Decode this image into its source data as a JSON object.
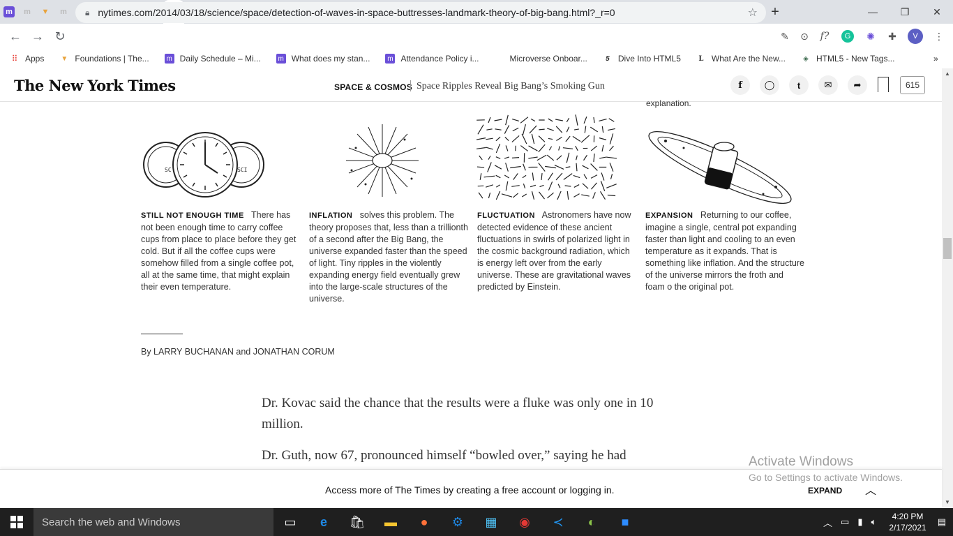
{
  "browser": {
    "url": "nytimes.com/2014/03/18/science/space/detection-of-waves-in-space-buttresses-landmark-theory-of-big-bang.html?_r=0",
    "new_tab_label": "+",
    "bookmarks": [
      {
        "label": "Apps",
        "icon": "apps-grid-icon",
        "color": "#e8453c"
      },
      {
        "label": "Foundations | The...",
        "icon": "foundations-icon",
        "color": "#e8a33d"
      },
      {
        "label": "Daily Schedule – Mi...",
        "icon": "microverse-icon",
        "color": "#6a4fd8"
      },
      {
        "label": "What does my stan...",
        "icon": "microverse-icon",
        "color": "#6a4fd8"
      },
      {
        "label": "Attendance Policy i...",
        "icon": "microverse-icon",
        "color": "#6a4fd8"
      },
      {
        "label": "Microverse Onboar...",
        "icon": "blank-icon",
        "color": "#ffffff"
      },
      {
        "label": "Dive Into HTML5",
        "icon": "five-icon",
        "color": "#111111"
      },
      {
        "label": "What Are the New...",
        "icon": "l-icon",
        "color": "#111111"
      },
      {
        "label": "HTML5 - New Tags...",
        "icon": "diamond-icon",
        "color": "#3d6b4f"
      }
    ],
    "more_bookmarks": "»",
    "profile_initial": "V"
  },
  "nyt": {
    "logo": "The New York Times",
    "section": "SPACE & COSMOS",
    "headline": "Space Ripples Reveal Big Bang’s Smoking Gun",
    "comment_count": "615",
    "share": {
      "facebook": "f",
      "twitter": "t"
    }
  },
  "graphic": {
    "top_cut": "explanation.",
    "mug_left_label": "SC",
    "mug_right_label": "SCI",
    "columns": [
      {
        "heading": "STILL NOT ENOUGH TIME",
        "text": "There has not been enough time to carry coffee cups from place to place before they get cold. But if all the coffee cups were somehow filled from a single coffee pot, all at the same time, that might explain their even temperature."
      },
      {
        "heading": "INFLATION",
        "text": "solves this problem. The theory proposes that, less than a trillionth of a second after the Big Bang, the universe expanded faster than the speed of light. Tiny ripples in the violently expanding energy field eventually grew into the large-scale structures of the universe."
      },
      {
        "heading": "FLUCTUATION",
        "text": "Astronomers have now detected evidence of these ancient fluctuations in swirls of polarized light in the cosmic background radiation, which is energy left over from the early universe. These are gravitational waves predicted by Einstein."
      },
      {
        "heading": "EXPANSION",
        "text": "Returning to our coffee, imagine a single, central pot expanding faster than light and cooling to an even temperature as it expands. That is something like inflation. And the structure of the universe mirrors the froth and foam o the original pot."
      }
    ],
    "byline": "By LARRY BUCHANAN and JONATHAN CORUM"
  },
  "article": {
    "para1": "Dr. Kovac said the chance that the results were a fluke was only one in 10 million.",
    "para2": "Dr. Guth, now 67, pronounced himself “bowled over,” saying he had"
  },
  "footer": {
    "text": "Access more of The Times by creating a free account or logging in.",
    "expand": "EXPAND",
    "watermark_title": "Activate Windows",
    "watermark_sub": "Go to Settings to activate Windows."
  },
  "taskbar": {
    "search_placeholder": "Search the web and Windows",
    "time": "4:20 PM",
    "date": "2/17/2021"
  }
}
